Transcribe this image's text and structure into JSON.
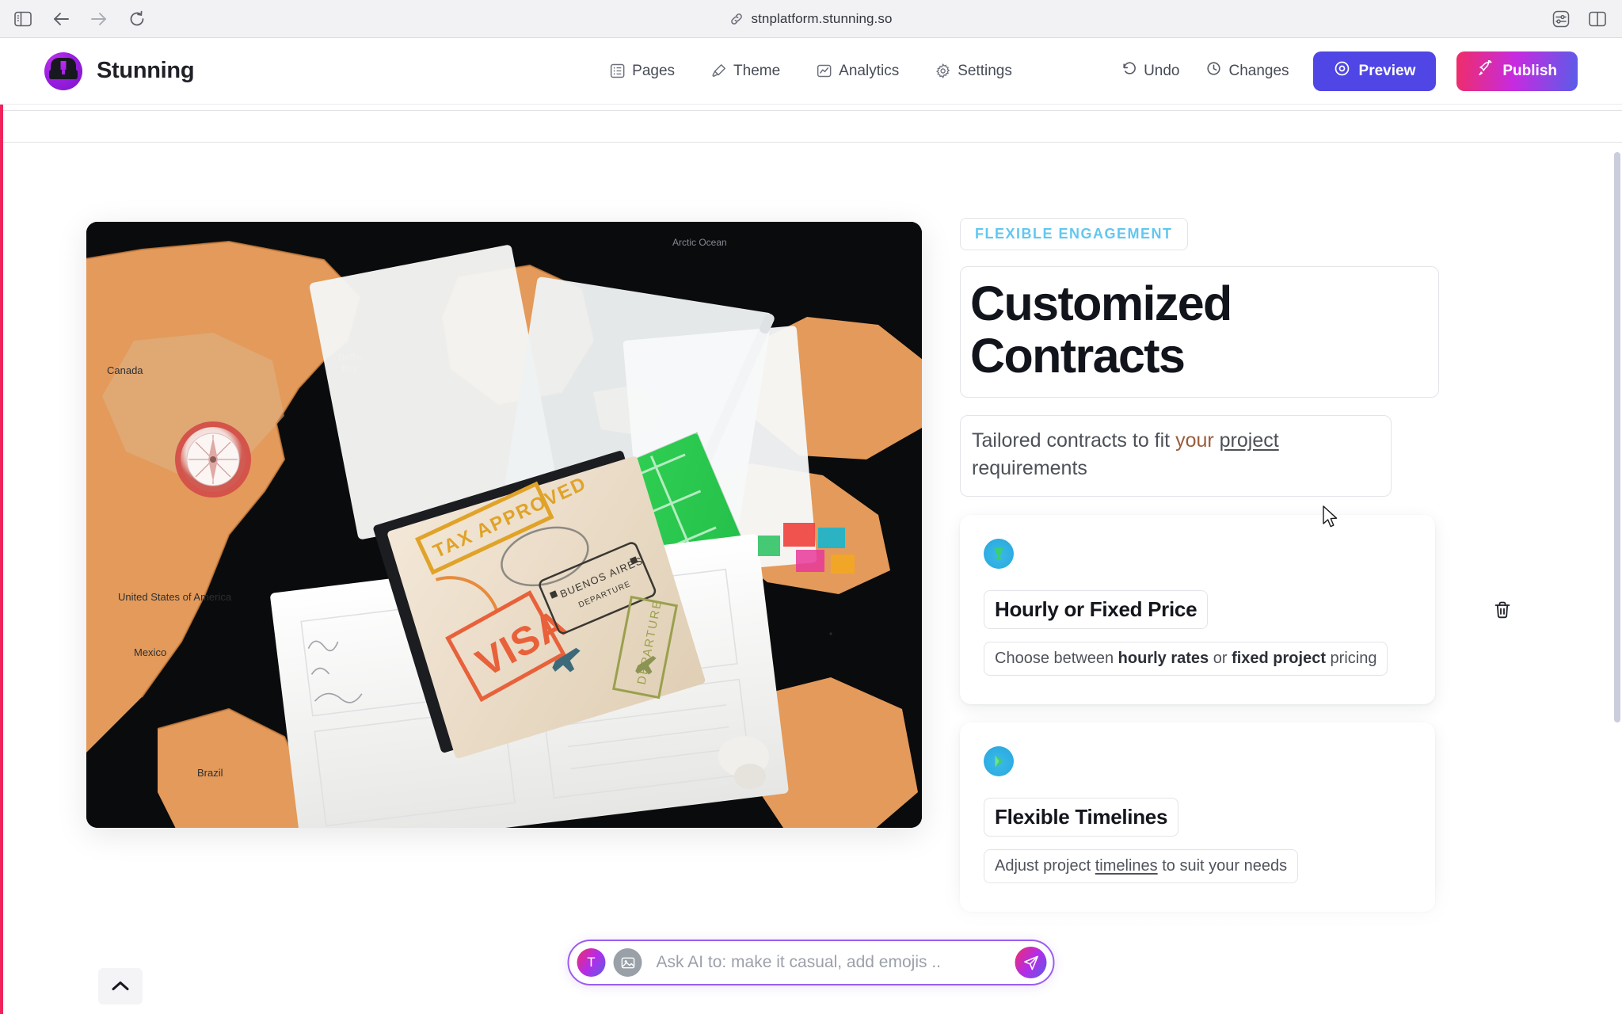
{
  "browser": {
    "url": "stnplatform.stunning.so",
    "icons": {
      "sidebar_toggle": "sidebar-panel-icon",
      "back": "back-arrow-icon",
      "forward": "forward-arrow-icon",
      "reload": "reload-icon",
      "link": "link-icon",
      "settings": "browser-settings-icon",
      "split_view": "split-view-icon"
    }
  },
  "app": {
    "brand_name": "Stunning",
    "nav": [
      {
        "label": "Pages",
        "icon": "pages-icon"
      },
      {
        "label": "Theme",
        "icon": "paintbrush-icon"
      },
      {
        "label": "Analytics",
        "icon": "chart-icon"
      },
      {
        "label": "Settings",
        "icon": "gear-icon"
      }
    ],
    "actions": {
      "undo": "Undo",
      "changes": "Changes",
      "preview": "Preview",
      "publish": "Publish"
    },
    "colors": {
      "preview_bg": "#4f46e5",
      "publish_gradient_start": "#ef2d68",
      "publish_gradient_mid": "#c62be0",
      "publish_gradient_end": "#5b5ce8",
      "brand_purple": "#9b1fe0",
      "selection_rule": "#f0245c",
      "eyebrow_blue": "#63c7ef"
    }
  },
  "hero": {
    "image_alt": "scratch-off world map with compass, passport with visa stamps, city maps and a pen",
    "eyebrow": "FLEXIBLE ENGAGEMENT",
    "title": "Customized Contracts",
    "subtitle_prefix": "Tailored contracts to fit ",
    "subtitle_accent": "your",
    "subtitle_mid": " ",
    "subtitle_link": "project",
    "subtitle_suffix": " requirements"
  },
  "features": [
    {
      "icon": "blue-circle-green-glyph-icon",
      "title": "Hourly or Fixed Price",
      "desc_parts": [
        {
          "text": "Choose between ",
          "style": "normal"
        },
        {
          "text": "hourly rates",
          "style": "bold"
        },
        {
          "text": " or ",
          "style": "normal"
        },
        {
          "text": "fixed project",
          "style": "bold"
        },
        {
          "text": " pricing",
          "style": "normal"
        }
      ]
    },
    {
      "icon": "blue-circle-green-glyph-icon",
      "title": "Flexible Timelines",
      "desc_parts": [
        {
          "text": "Adjust project ",
          "style": "normal"
        },
        {
          "text": "timelines",
          "style": "underline"
        },
        {
          "text": " to suit your needs",
          "style": "normal"
        }
      ]
    }
  ],
  "ai_bar": {
    "placeholder": "Ask AI to: make it casual, add emojis ..",
    "value": "",
    "text_chip_label": "T",
    "image_chip_icon": "image-icon",
    "send_icon": "send-icon"
  },
  "canvas": {
    "delete_icon": "trash-icon",
    "collapse_icon": "chevron-up-icon"
  }
}
